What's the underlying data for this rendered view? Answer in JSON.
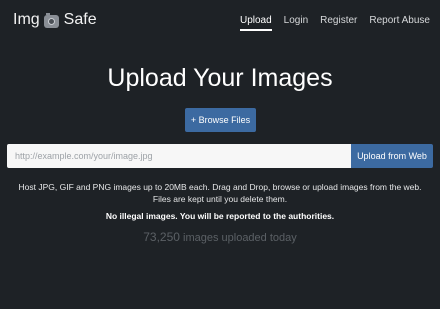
{
  "brand": {
    "left": "Img",
    "right": "Safe",
    "icon": "camera-icon"
  },
  "nav": {
    "items": [
      {
        "label": "Upload",
        "active": true
      },
      {
        "label": "Login",
        "active": false
      },
      {
        "label": "Register",
        "active": false
      },
      {
        "label": "Report Abuse",
        "active": false
      }
    ]
  },
  "hero": {
    "title": "Upload Your Images",
    "browse_label": "+ Browse Files"
  },
  "url_upload": {
    "placeholder": "http://example.com/your/image.jpg",
    "value": "",
    "button_label": "Upload from Web"
  },
  "info": {
    "description": "Host JPG, GIF and PNG images up to 20MB each. Drag and Drop, browse or upload images from the web. Files are kept until you delete them.",
    "warning": "No illegal images. You will be reported to the authorities.",
    "count_value": "73,250",
    "count_label": "images uploaded today"
  },
  "colors": {
    "background": "#1e2226",
    "accent": "#3c6aa1",
    "muted_text": "#5b6065"
  }
}
